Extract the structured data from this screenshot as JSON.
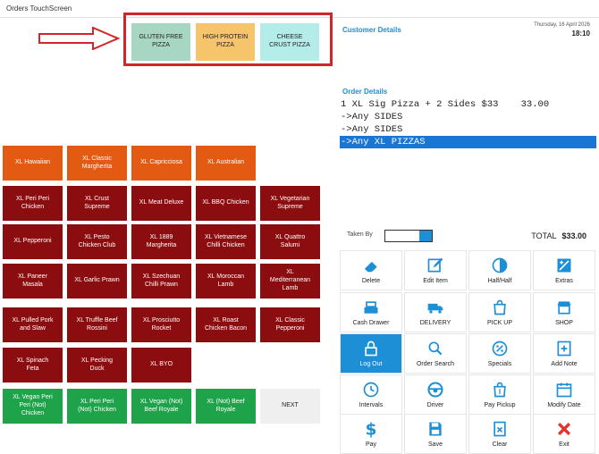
{
  "window": {
    "title": "Orders TouchScreen"
  },
  "categories": [
    {
      "label": "GLUTEN FREE\nPIZZA",
      "color": "#a7d6c2"
    },
    {
      "label": "HIGH PROTEIN\nPIZZA",
      "color": "#f6c46a"
    },
    {
      "label": "CHEESE\nCRUST PIZZA",
      "color": "#b3ece9"
    }
  ],
  "menu": {
    "items": [
      {
        "label": "XL Hawaiian",
        "color": "orange"
      },
      {
        "label": "XL Classic\nMargherita",
        "color": "orange"
      },
      {
        "label": "XL Capricciosa",
        "color": "orange"
      },
      {
        "label": "XL Australian",
        "color": "orange"
      },
      {
        "label": "XL Peri Peri\nChicken",
        "color": "red"
      },
      {
        "label": "XL Crust\nSupreme",
        "color": "red"
      },
      {
        "label": "XL Meat Deluxe",
        "color": "red"
      },
      {
        "label": "XL BBQ Chicken",
        "color": "red"
      },
      {
        "label": "XL Vegetarian\nSupreme",
        "color": "red"
      },
      {
        "label": "XL Pepperoni",
        "color": "red"
      },
      {
        "label": "XL Pesto\nChicken Club",
        "color": "red"
      },
      {
        "label": "XL 1889\nMargherita",
        "color": "red"
      },
      {
        "label": "XL Vietnamese\nChilli Chicken",
        "color": "red"
      },
      {
        "label": "XL Quattro\nSalumi",
        "color": "red"
      },
      {
        "label": "XL Paneer\nMasala",
        "color": "red"
      },
      {
        "label": "XL Garlic Prawn",
        "color": "red"
      },
      {
        "label": "XL Szechuan\nChilli Prawn",
        "color": "red"
      },
      {
        "label": "XL Moroccan\nLamb",
        "color": "red"
      },
      {
        "label": "XL\nMediterranean\nLamb",
        "color": "red"
      },
      {
        "label": "XL Pulled Pork\nand Slaw",
        "color": "red"
      },
      {
        "label": "XL Truffle Beef\nRossini",
        "color": "red"
      },
      {
        "label": "XL Prosciutto\nRocket",
        "color": "red"
      },
      {
        "label": "XL Roast\nChicken  Bacon",
        "color": "red"
      },
      {
        "label": "XL Classic\nPepperoni",
        "color": "red"
      },
      {
        "label": "XL Spinach\nFeta",
        "color": "red"
      },
      {
        "label": "XL Pecking\nDuck",
        "color": "red"
      },
      {
        "label": "XL BYO",
        "color": "red"
      },
      {
        "label": "XL Vegan Peri\nPeri (Not)\nChicken",
        "color": "green"
      },
      {
        "label": "XL Peri Peri\n(Not) Chicken",
        "color": "green"
      },
      {
        "label": "XL Vegan (Not)\nBeef Royale",
        "color": "green"
      },
      {
        "label": "XL (Not) Beef\nRoyale",
        "color": "green"
      },
      {
        "label": "NEXT",
        "color": "grey"
      }
    ]
  },
  "customer": {
    "label": "Customer Details",
    "date": "Thursday, 16 April 2026",
    "time": "18:10"
  },
  "order": {
    "label": "Order Details",
    "lines": [
      {
        "text": "1 XL Sig Pizza + 2 Sides $33    33.00",
        "selected": false
      },
      {
        "text": "->Any SIDES",
        "selected": false
      },
      {
        "text": "->Any SIDES",
        "selected": false
      },
      {
        "text": "->Any XL PIZZAS",
        "selected": true
      }
    ]
  },
  "taken_by": {
    "label": "Taken By"
  },
  "total": {
    "label": "TOTAL",
    "value": "$33.00"
  },
  "actions": [
    {
      "label": "Delete",
      "icon": "eraser-icon"
    },
    {
      "label": "Edit Item",
      "icon": "edit-icon"
    },
    {
      "label": "Half/Half",
      "icon": "half-circle-icon"
    },
    {
      "label": "Extras",
      "icon": "extras-icon"
    },
    {
      "label": "Cash Drawer",
      "icon": "cash-register-icon"
    },
    {
      "label": "DELIVERY",
      "icon": "delivery-truck-icon"
    },
    {
      "label": "PICK UP",
      "icon": "pickup-bag-icon"
    },
    {
      "label": "SHOP",
      "icon": "shop-icon"
    },
    {
      "label": "Log Out",
      "icon": "lock-icon"
    },
    {
      "label": "Order Search",
      "icon": "search-icon"
    },
    {
      "label": "Specials",
      "icon": "specials-icon"
    },
    {
      "label": "Add Note",
      "icon": "note-icon"
    },
    {
      "label": "Intervals",
      "icon": "clock-icon"
    },
    {
      "label": "Driver",
      "icon": "steering-wheel-icon"
    },
    {
      "label": "Pay Pickup",
      "icon": "pay-pickup-icon"
    },
    {
      "label": "Modify Date",
      "icon": "calendar-icon"
    },
    {
      "label": "Pay",
      "icon": "dollar-icon"
    },
    {
      "label": "Save",
      "icon": "save-icon"
    },
    {
      "label": "Clear",
      "icon": "clear-icon"
    },
    {
      "label": "Exit",
      "icon": "exit-icon"
    }
  ],
  "colors": {
    "accent": "#1c8fd6",
    "highlight": "#d0252a"
  }
}
